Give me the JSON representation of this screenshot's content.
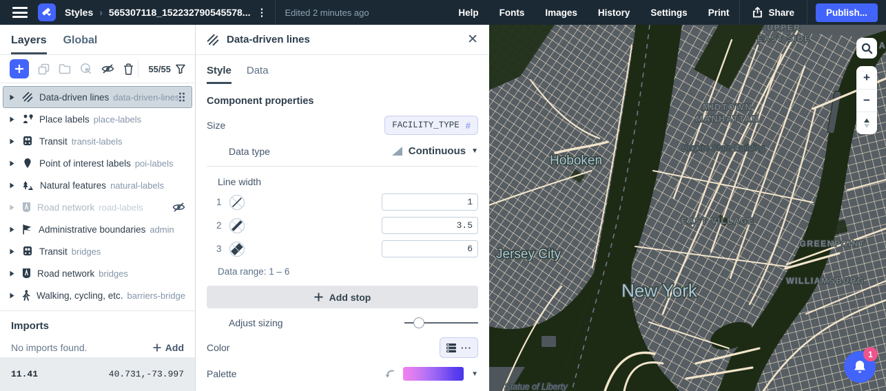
{
  "topbar": {
    "breadcrumb": {
      "section": "Styles",
      "style_name": "565307118_152232790545578..."
    },
    "edited": "Edited 2 minutes ago",
    "menu": [
      "Help",
      "Fonts",
      "Images",
      "History",
      "Settings",
      "Print"
    ],
    "share_label": "Share",
    "publish_label": "Publish..."
  },
  "sidebar": {
    "tabs": [
      {
        "label": "Layers",
        "active": true
      },
      {
        "label": "Global",
        "active": false
      }
    ],
    "counter": "55/55",
    "layers": [
      {
        "name": "Data-driven lines",
        "id": "data-driven-lines",
        "selected": true
      },
      {
        "name": "Place labels",
        "id": "place-labels"
      },
      {
        "name": "Transit",
        "id": "transit-labels"
      },
      {
        "name": "Point of interest labels",
        "id": "poi-labels"
      },
      {
        "name": "Natural features",
        "id": "natural-labels"
      },
      {
        "name": "Road network",
        "id": "road-labels",
        "hidden": true
      },
      {
        "name": "Administrative boundaries",
        "id": "admin"
      },
      {
        "name": "Transit",
        "id": "bridges"
      },
      {
        "name": "Road network",
        "id": "bridges"
      },
      {
        "name": "Walking, cycling, etc.",
        "id": "barriers-bridges"
      }
    ],
    "imports": {
      "title": "Imports",
      "empty_text": "No imports found.",
      "add_label": "Add"
    },
    "footer": {
      "zoom": "11.41",
      "coords": "40.731,-73.997"
    }
  },
  "panel": {
    "title": "Data-driven lines",
    "tabs": [
      {
        "label": "Style",
        "active": true
      },
      {
        "label": "Data",
        "active": false
      }
    ],
    "section_title": "Component properties",
    "size": {
      "label": "Size",
      "field": "FACILITY_TYPE",
      "hash": "#"
    },
    "data_type": {
      "label": "Data type",
      "value": "Continuous"
    },
    "line_width": {
      "label": "Line width",
      "stops": [
        {
          "index": "1",
          "value": "1"
        },
        {
          "index": "2",
          "value": "3.5"
        },
        {
          "index": "3",
          "value": "6"
        }
      ],
      "range_text": "Data range: 1 – 6",
      "add_stop_label": "Add stop"
    },
    "adjust_sizing": {
      "label": "Adjust sizing",
      "position_pct": 20
    },
    "color": {
      "label": "Color",
      "dots": "···"
    },
    "palette": {
      "label": "Palette",
      "colors": [
        "#f183ec",
        "#e07df0",
        "#c778f3",
        "#ad6ef5",
        "#9361f4",
        "#7a50f1",
        "#5b3eee",
        "#4936ea"
      ]
    }
  },
  "map": {
    "labels": {
      "upper_east_side_1": "UPPER",
      "upper_east_side_2": "EAST SIDE",
      "midtown_1": "MIDTOWN",
      "midtown_2": "MANHATTAN",
      "empire_state": "Empire State Building",
      "hoboken": "Hoboken",
      "east_village": "EAST VILLAGE",
      "jersey_city": "Jersey City",
      "greenpoint": "GREENPOINT",
      "new_york": "New York",
      "williamsburg": "WILLIAMSBURG",
      "statue_of_liberty": "Statue of Liberty",
      "edge_partial": "A"
    },
    "controls": {
      "zoom_in": "+",
      "zoom_out": "−"
    }
  },
  "notification": {
    "count": "1"
  },
  "colors": {
    "accent": "#4264fb",
    "notification_badge": "#f0538d",
    "map_land": "#545b61",
    "map_water": "#1d2b15",
    "map_street": "#efe2c8",
    "label_city": "#a9c6da",
    "label_neighborhood": "#747f88"
  }
}
